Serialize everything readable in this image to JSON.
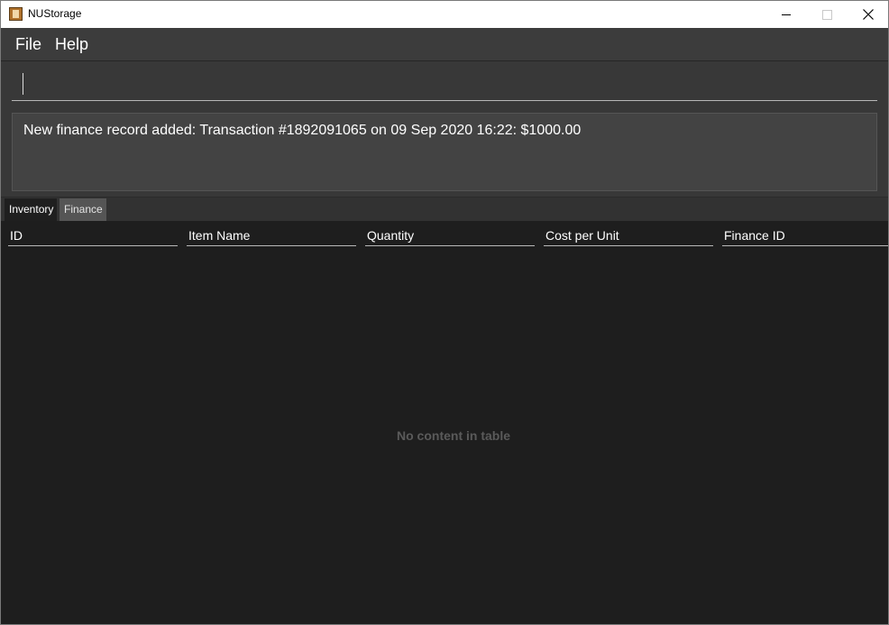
{
  "window": {
    "title": "NUStorage",
    "minimize_label": "",
    "maximize_label": "",
    "close_label": ""
  },
  "menu": {
    "items": [
      {
        "label": "File"
      },
      {
        "label": "Help"
      }
    ]
  },
  "command": {
    "value": "",
    "placeholder": ""
  },
  "result": {
    "message": "New finance record added: Transaction #1892091065 on 09 Sep 2020 16:22: $1000.00"
  },
  "tabs": [
    {
      "label": "Inventory",
      "selected": true
    },
    {
      "label": "Finance",
      "selected": false
    }
  ],
  "table": {
    "columns": [
      "ID",
      "Item Name",
      "Quantity",
      "Cost per Unit",
      "Finance ID"
    ],
    "rows": [],
    "empty_message": "No content in table"
  },
  "icons": {
    "app": "storage-app-icon",
    "minimize": "minimize-icon",
    "maximize": "maximize-icon",
    "close": "close-icon"
  },
  "colors": {
    "background": "#2b2b2b",
    "menubar": "#3c3c3c",
    "table_background": "#1e1e1e",
    "text": "#ffffff",
    "muted_text": "#5a5a5a"
  }
}
